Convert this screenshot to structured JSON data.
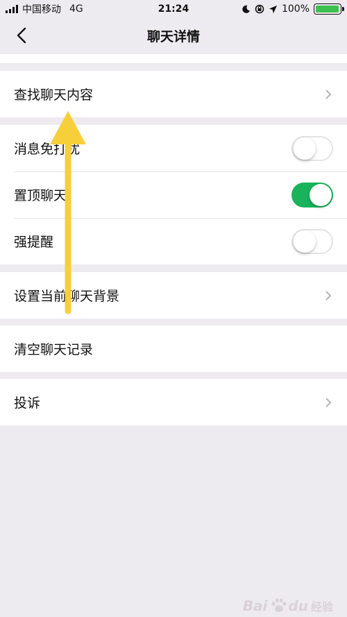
{
  "status_bar": {
    "carrier": "中国移动",
    "network": "4G",
    "time": "21:24",
    "battery": "100%",
    "battery_level": 1.0
  },
  "nav": {
    "title": "聊天详情",
    "back_icon": "chevron-left-icon"
  },
  "groups": {
    "search": {
      "label": "查找聊天内容"
    },
    "switches": [
      {
        "label": "消息免打扰",
        "on": false
      },
      {
        "label": "置顶聊天",
        "on": true
      },
      {
        "label": "强提醒",
        "on": false
      }
    ],
    "background": {
      "label": "设置当前聊天背景"
    },
    "clear": {
      "label": "清空聊天记录"
    },
    "report": {
      "label": "投诉"
    }
  },
  "colors": {
    "toggle_on": "#18b35a",
    "arrow": "#f7cf3b",
    "page_bg": "#eeebf0"
  },
  "watermark": {
    "brand": "Bai",
    "brand2": "du",
    "sub": "经验"
  }
}
